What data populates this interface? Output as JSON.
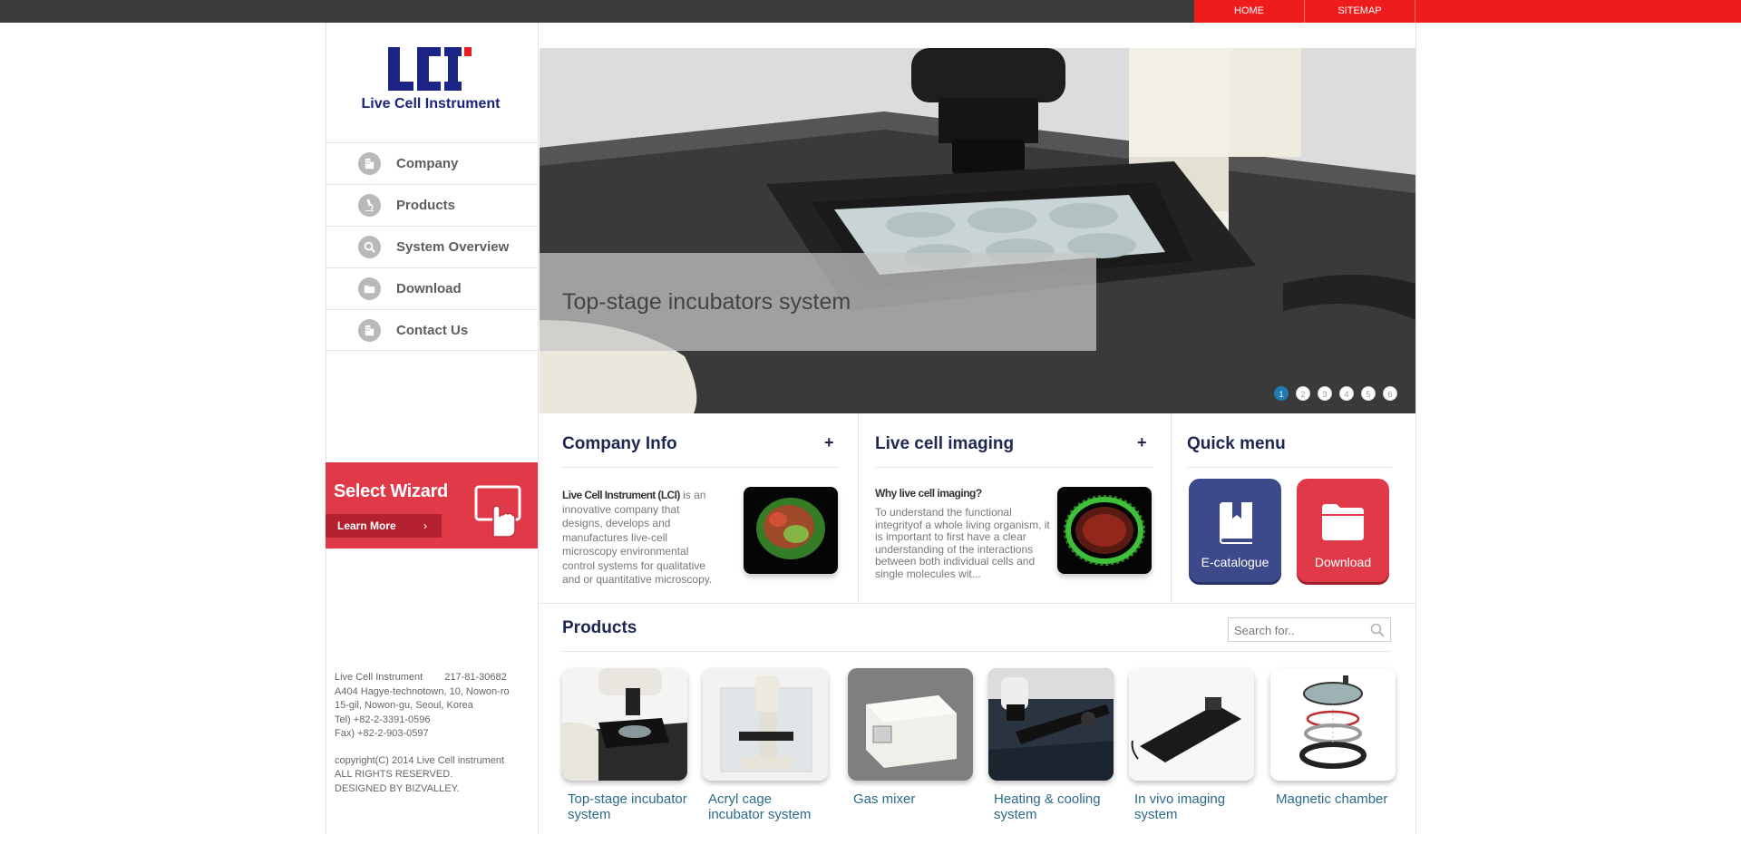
{
  "topnav": {
    "home": "HOME",
    "sitemap": "SITEMAP"
  },
  "brand": {
    "logo_mark": "LCI",
    "name": "Live Cell Instrument"
  },
  "sidebar": {
    "items": [
      {
        "label": "Company",
        "icon": "building-icon"
      },
      {
        "label": "Products",
        "icon": "microscope-icon"
      },
      {
        "label": "System Overview",
        "icon": "magnifier-icon"
      },
      {
        "label": "Download",
        "icon": "folder-icon"
      },
      {
        "label": "Contact Us",
        "icon": "building-icon"
      }
    ],
    "wizard": {
      "title": "Select Wizard",
      "button": "Learn More",
      "arrow": "›"
    },
    "footer": {
      "company": "Live Cell Instrument",
      "reg_no": "217-81-30682",
      "address1": "A404 Hagye-technotown, 10, Nowon-ro",
      "address2": "15-gil, Nowon-gu, Seoul, Korea",
      "tel": "Tel) +82-2-3391-0596",
      "fax": "Fax) +82-2-903-0597",
      "copyright": "copyright(C) 2014 Live Cell instrument",
      "rights": "ALL RIGHTS RESERVED.",
      "designer": "DESIGNED BY BIZVALLEY."
    }
  },
  "hero": {
    "caption": "Top-stage incubators system",
    "dots": [
      "1",
      "2",
      "3",
      "4",
      "5",
      "6"
    ],
    "active_dot": 1
  },
  "company_info": {
    "title": "Company Info",
    "plus": "+",
    "lead": "Live Cell Instrument (LCI)",
    "text": " is an innovative company that designs, develops and manufactures live-cell microscopy environmental control systems for qualitative and or quantitative microscopy."
  },
  "live_cell": {
    "title": "Live cell imaging",
    "plus": "+",
    "subtitle": "Why live cell imaging?",
    "text": "To understand the functional integrityof a whole living organism, it is important to first have a clear understanding of the interactions between both individual cells and single molecules wit..."
  },
  "quick_menu": {
    "title": "Quick menu",
    "ecatalogue": "E-catalogue",
    "download": "Download"
  },
  "products": {
    "title": "Products",
    "search_placeholder": "Search for..",
    "items": [
      {
        "name": "Top-stage incubator system"
      },
      {
        "name": "Acryl cage incubator system"
      },
      {
        "name": "Gas mixer"
      },
      {
        "name": "Heating & cooling system"
      },
      {
        "name": "In vivo imaging system"
      },
      {
        "name": "Magnetic chamber"
      }
    ]
  },
  "colors": {
    "topbar": "#3b3b3b",
    "accent_red": "#ee1c1c",
    "wizard_red": "#e03a49",
    "navy": "#1d2752",
    "ecatalogue_blue": "#3c4a8c",
    "link_blue": "#2c6a8a"
  }
}
